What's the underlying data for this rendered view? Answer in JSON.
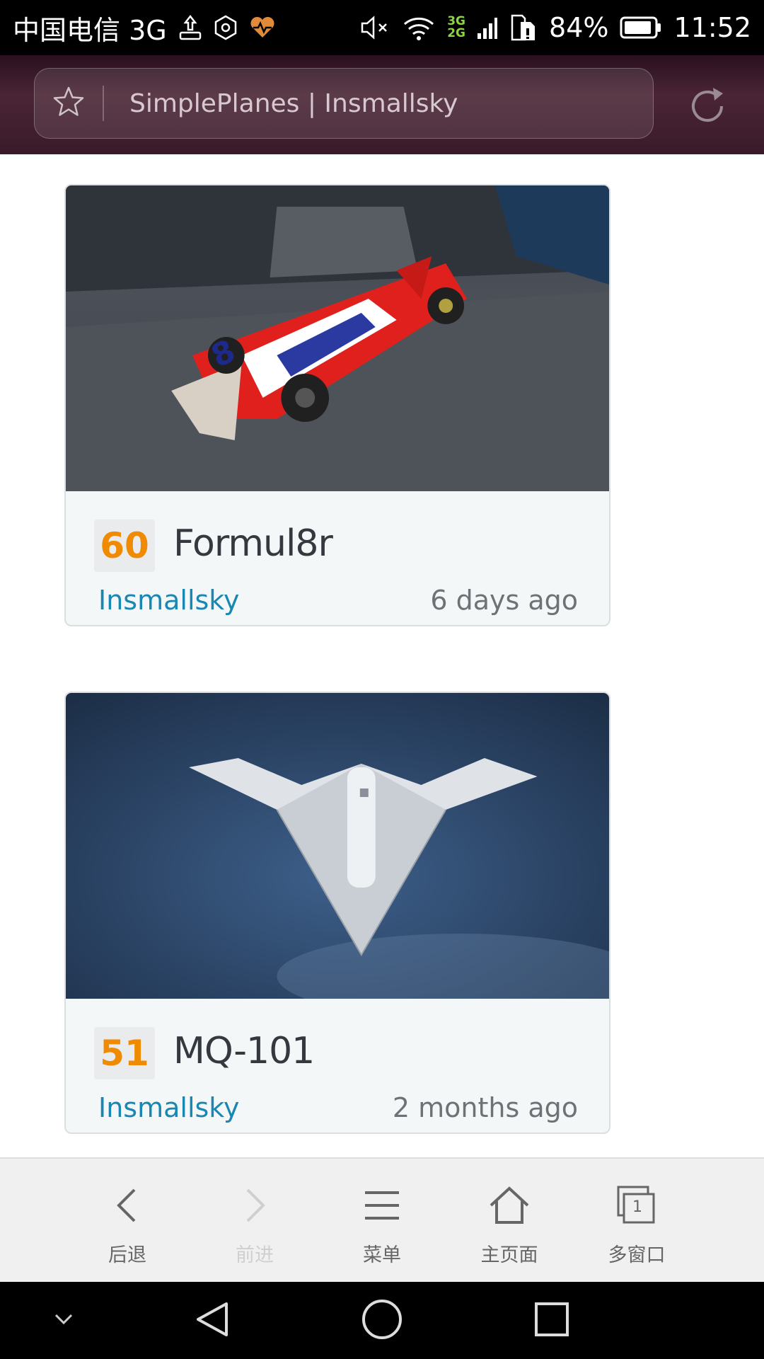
{
  "status_bar": {
    "carrier": "中国电信 3G",
    "network_top": "3G",
    "network_bottom": "2G",
    "battery": "84%",
    "time": "11:52",
    "icons": [
      "upload-icon",
      "settings-hex-icon",
      "health-heart-icon",
      "mute-icon",
      "wifi-icon",
      "signal-icon",
      "sim-icon",
      "battery-icon"
    ]
  },
  "address_bar": {
    "title": "SimplePlanes | Insmallsky",
    "icons": [
      "star-icon",
      "reload-icon"
    ]
  },
  "cards": [
    {
      "score": "60",
      "title": "Formul8r",
      "author": "Insmallsky",
      "time": "6 days ago"
    },
    {
      "score": "51",
      "title": "MQ-101",
      "author": "Insmallsky",
      "time": "2 months ago"
    }
  ],
  "toolbar": {
    "back": "后退",
    "forward": "前进",
    "menu": "菜单",
    "home": "主页面",
    "windows": "多窗口",
    "window_count": "1"
  },
  "colors": {
    "score": "#f08a00",
    "author_link": "#1a87b3",
    "title": "#33393f"
  }
}
